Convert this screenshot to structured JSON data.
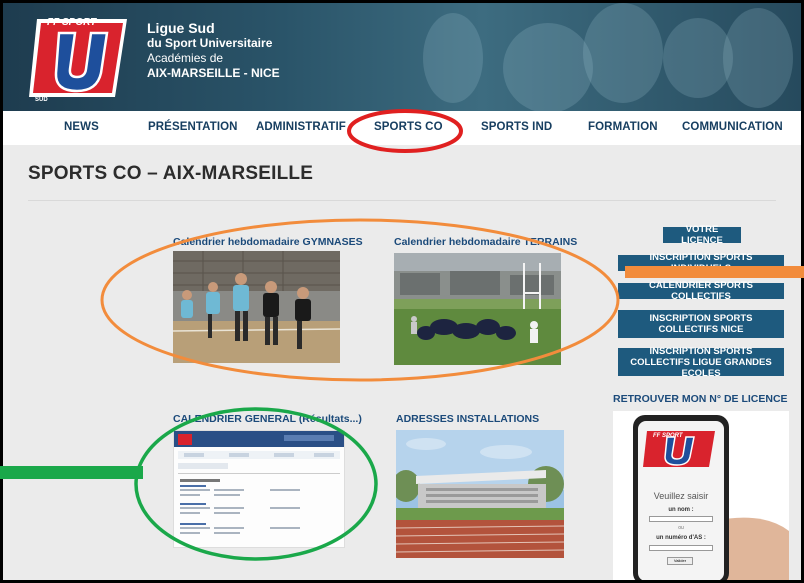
{
  "brand": {
    "logo_text": "FF SPORT",
    "logo_letter": "U",
    "logo_sub": "SUD",
    "line1": "Ligue Sud",
    "line2": "du Sport Universitaire",
    "line3": "Académies de",
    "line4": "AIX-MARSEILLE - NICE"
  },
  "nav": {
    "items": [
      "NEWS",
      "PRÉSENTATION",
      "ADMINISTRATIF",
      "SPORTS CO",
      "SPORTS IND",
      "FORMATION",
      "COMMUNICATION"
    ]
  },
  "page": {
    "title": "SPORTS CO – AIX-MARSEILLE"
  },
  "cards": [
    {
      "title": "Calendrier hebdomadaire GYMNASES"
    },
    {
      "title": "Calendrier hebdomadaire TERRAINS"
    },
    {
      "title": "CALENDRIER GENERAL (Résultats...)"
    },
    {
      "title": "ADRESSES INSTALLATIONS"
    }
  ],
  "sidebar": {
    "buttons": [
      "VOTRE LICENCE",
      "INSCRIPTION SPORTS INDIVIDUELS",
      "CALENDRIER SPORTS COLLECTIFS",
      "INSCRIPTION SPORTS COLLECTIFS NICE",
      "INSCRIPTION SPORTS COLLECTIFS LIGUE GRANDES ECOLES"
    ],
    "heading": "RETROUVER MON N° DE LICENCE"
  },
  "phone": {
    "logo_text": "FF SPORT",
    "logo_letter": "U",
    "prompt": "Veuillez saisir",
    "name_label": "un nom :",
    "or_label": "ou",
    "number_label": "un numéro d'AS :",
    "submit": "Valider"
  },
  "colors": {
    "nav_text": "#173e60",
    "accent_blue": "#1e5a7e",
    "annotation_red": "#e02020",
    "annotation_orange": "#f28c3c",
    "annotation_green": "#1aa84a"
  }
}
